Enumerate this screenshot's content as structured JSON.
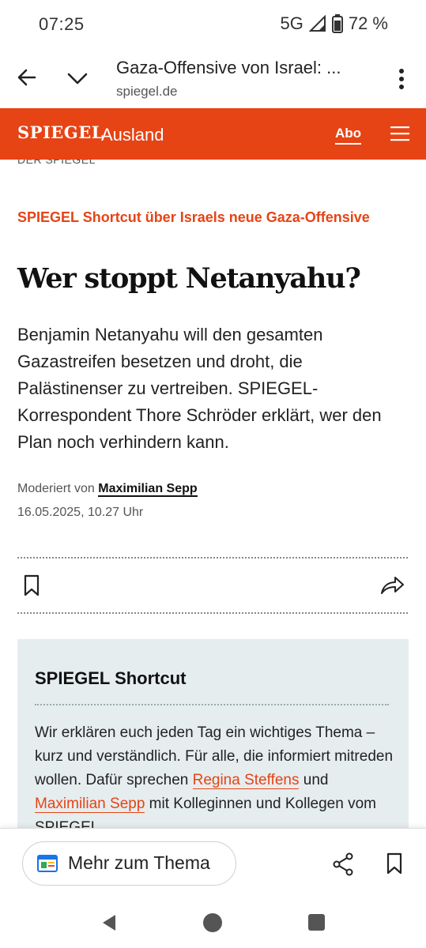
{
  "status_bar": {
    "time": "07:25",
    "network": "5G",
    "battery": "72 %"
  },
  "browser": {
    "page_title": "Gaza-Offensive von Israel: ...",
    "domain": "spiegel.de"
  },
  "site_header": {
    "logo": "SPIEGEL",
    "section": "Ausland",
    "abo_label": "Abo",
    "brand_color": "#e64415"
  },
  "article": {
    "image_credit": "DER SPIEGEL",
    "kicker": "SPIEGEL Shortcut über Israels neue Gaza-Offensive",
    "headline": "Wer stoppt Netanyahu?",
    "lead": "Benjamin Netanyahu will den gesamten Gazastreifen besetzen und droht, die Palästinenser zu vertreiben. SPIEGEL-Korrespondent Thore Schröder erklärt, wer den Plan noch verhindern kann.",
    "moderated_prefix": "Moderiert von",
    "moderator": "Maximilian Sepp",
    "date": "16.05.2025, 10.27 Uhr"
  },
  "info_box": {
    "title": "SPIEGEL Shortcut",
    "text_1": "Wir erklären euch jeden Tag ein wichtiges Thema – kurz und verständlich. Für alle, die informiert mitreden wollen. Dafür sprechen ",
    "link_1": "Regina Steffens",
    "text_2": " und ",
    "link_2": "Maximilian Sepp",
    "text_3": " mit Kolleginnen und Kollegen vom SPIEGEL."
  },
  "bottom_bar": {
    "chip_label": "Mehr zum Thema"
  }
}
